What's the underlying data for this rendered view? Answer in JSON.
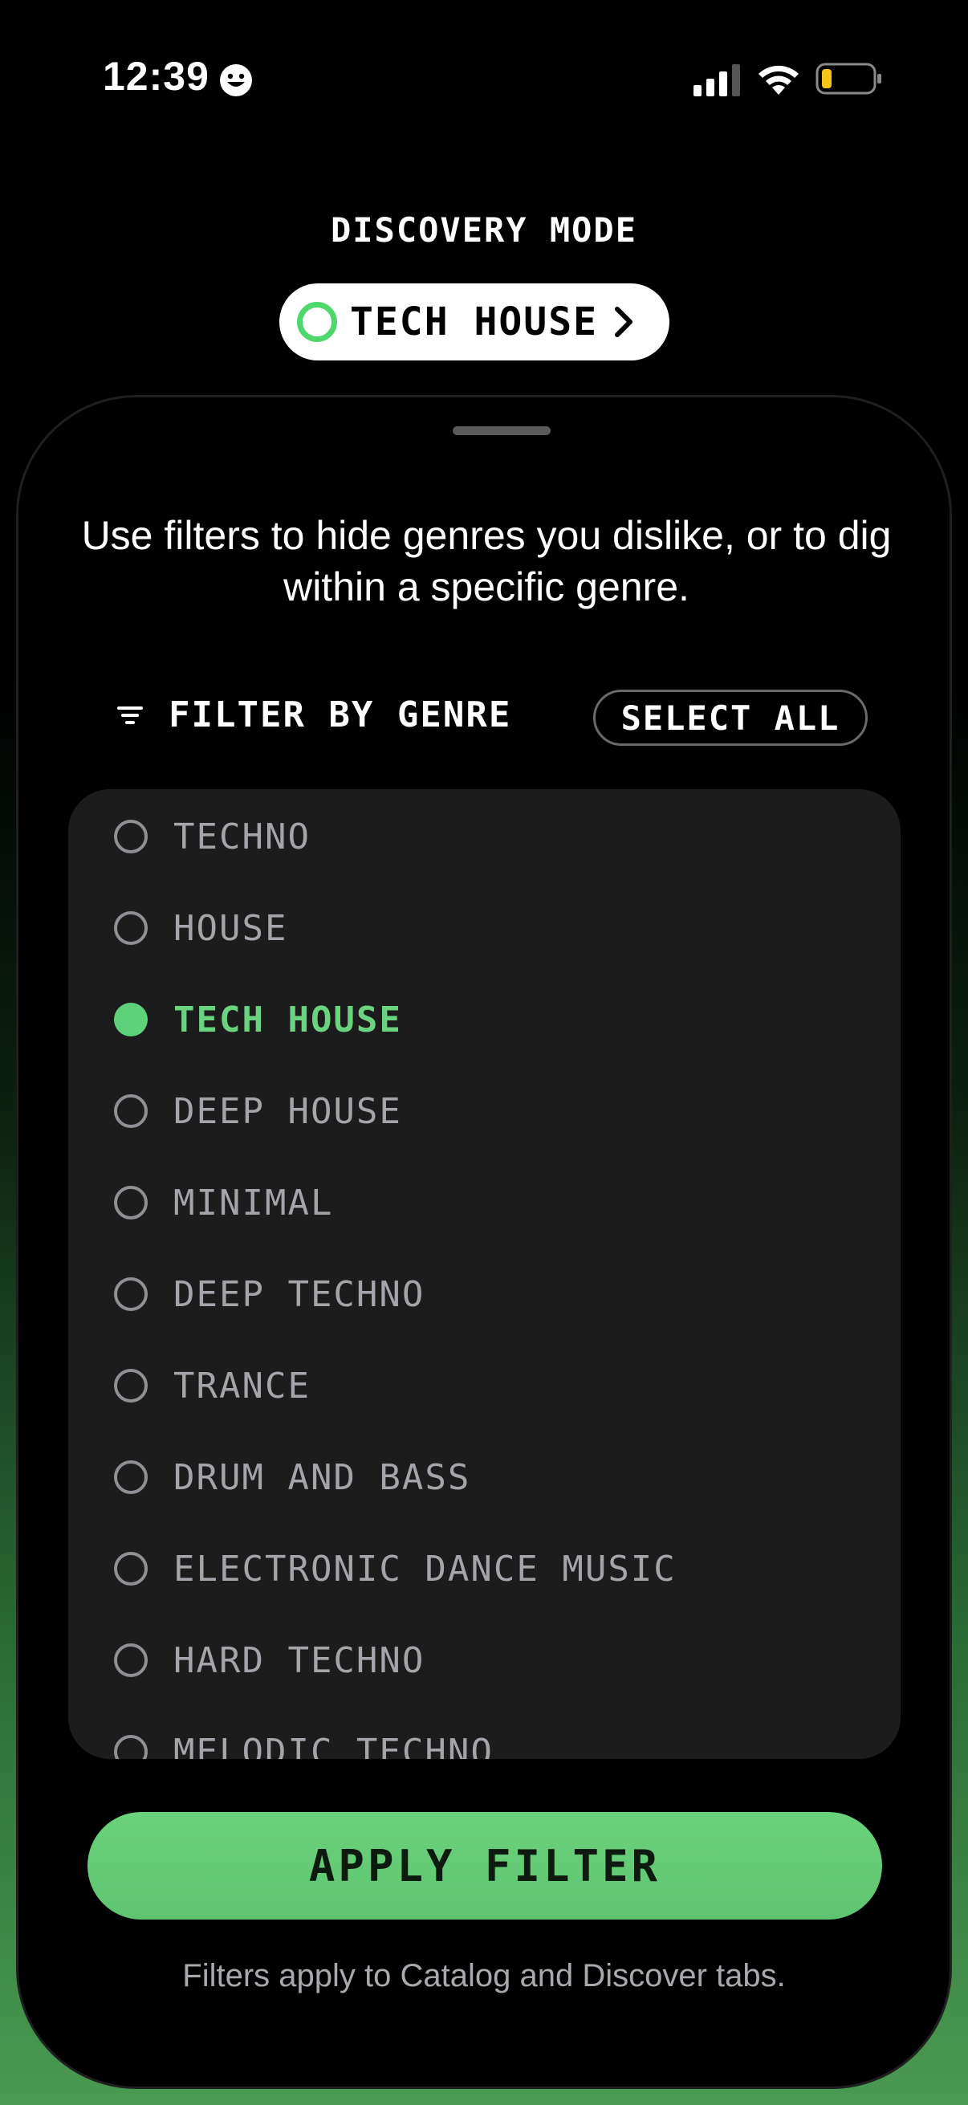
{
  "status_bar": {
    "time": "12:39"
  },
  "discovery": {
    "label": "DISCOVERY MODE",
    "current_genre": "TECH HOUSE",
    "accent_color": "#4ed86b"
  },
  "sheet": {
    "description": "Use filters to hide genres you dislike, or to dig within a specific genre.",
    "filter_title": "FILTER BY GENRE",
    "select_all_label": "SELECT ALL",
    "genres": [
      {
        "label": "TECHNO",
        "selected": false
      },
      {
        "label": "HOUSE",
        "selected": false
      },
      {
        "label": "TECH HOUSE",
        "selected": true
      },
      {
        "label": "DEEP HOUSE",
        "selected": false
      },
      {
        "label": "MINIMAL",
        "selected": false
      },
      {
        "label": "DEEP TECHNO",
        "selected": false
      },
      {
        "label": "TRANCE",
        "selected": false
      },
      {
        "label": "DRUM AND BASS",
        "selected": false
      },
      {
        "label": "ELECTRONIC DANCE MUSIC",
        "selected": false
      },
      {
        "label": "HARD TECHNO",
        "selected": false
      },
      {
        "label": "MELODIC TECHNO",
        "selected": false
      }
    ],
    "apply_label": "APPLY FILTER",
    "footnote": "Filters apply to Catalog and Discover tabs."
  },
  "colors": {
    "selected_green": "#5dd27a",
    "button_green": "#6bd27c"
  }
}
